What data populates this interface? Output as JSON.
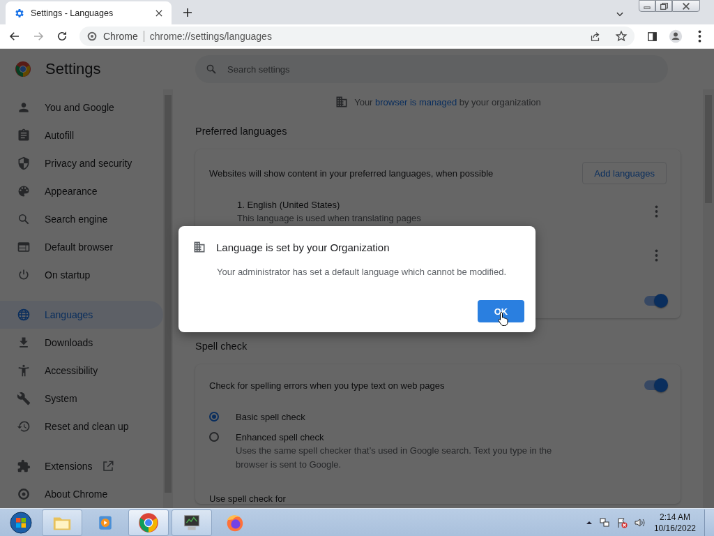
{
  "browser": {
    "tab": {
      "title": "Settings - Languages",
      "selected": true
    },
    "site_label": "Chrome",
    "url": "chrome://settings/languages"
  },
  "settings": {
    "title": "Settings",
    "search": {
      "placeholder": "Search settings"
    },
    "nav": [
      {
        "label": "You and Google",
        "selected": false
      },
      {
        "label": "Autofill",
        "selected": false
      },
      {
        "label": "Privacy and security",
        "selected": false
      },
      {
        "label": "Appearance",
        "selected": false
      },
      {
        "label": "Search engine",
        "selected": false
      },
      {
        "label": "Default browser",
        "selected": false
      },
      {
        "label": "On startup",
        "selected": false
      },
      {
        "label": "Languages",
        "selected": true
      },
      {
        "label": "Downloads",
        "selected": false
      },
      {
        "label": "Accessibility",
        "selected": false
      },
      {
        "label": "System",
        "selected": false
      },
      {
        "label": "Reset and clean up",
        "selected": false
      },
      {
        "label": "Extensions",
        "selected": false
      },
      {
        "label": "About Chrome",
        "selected": false
      }
    ],
    "managed_notice": {
      "before": "Your ",
      "link": "browser is managed",
      "after": " by your organization"
    },
    "preferred_languages": {
      "heading": "Preferred languages",
      "description": "Websites will show content in your preferred languages, when possible",
      "add_button": "Add languages",
      "languages": [
        {
          "name": "1. English (United States)",
          "description": "This language is used when translating pages"
        }
      ],
      "translate_toggle": {
        "on": true
      }
    },
    "spell_check": {
      "heading": "Spell check",
      "toggle": {
        "label": "Check for spelling errors when you type text on web pages",
        "on": true
      },
      "options": [
        {
          "label": "Basic spell check",
          "selected": true
        },
        {
          "label": "Enhanced spell check",
          "description": "Uses the same spell checker that’s used in Google search. Text you type in the browser is sent to Google.",
          "selected": false
        }
      ],
      "use_for_label": "Use spell check for"
    }
  },
  "dialog": {
    "title": "Language is set by your Organization",
    "message": "Your administrator has set a default language which cannot be modified.",
    "ok_button": "OK"
  },
  "taskbar": {
    "time": "2:14 AM",
    "date": "10/16/2022"
  }
}
